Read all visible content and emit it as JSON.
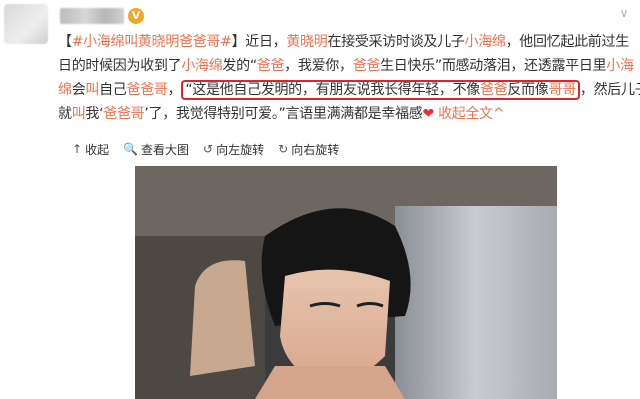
{
  "post": {
    "line1": [
      {
        "t": "【",
        "h": false
      },
      {
        "t": "#小海绵叫黄晓明爸爸哥#",
        "h": true
      },
      {
        "t": "】近日，",
        "h": false
      },
      {
        "t": "黄晓明",
        "h": true
      },
      {
        "t": "在接受采访时谈及儿子",
        "h": false
      },
      {
        "t": "小海绵",
        "h": true
      },
      {
        "t": "，他回忆起此前过生",
        "h": false
      }
    ],
    "line2": [
      {
        "t": "日的时候因为收到了",
        "h": false
      },
      {
        "t": "小海绵",
        "h": true
      },
      {
        "t": "发的“",
        "h": false
      },
      {
        "t": "爸爸",
        "h": true
      },
      {
        "t": "，我爱你，",
        "h": false
      },
      {
        "t": "爸爸",
        "h": true
      },
      {
        "t": "生日快乐”而感动落泪，还透露平日里",
        "h": false
      },
      {
        "t": "小海",
        "h": true
      }
    ],
    "line3_pre": [
      {
        "t": "绵",
        "h": true
      },
      {
        "t": "会",
        "h": false
      },
      {
        "t": "叫",
        "h": true
      },
      {
        "t": "自己",
        "h": false
      },
      {
        "t": "爸爸哥",
        "h": true
      },
      {
        "t": "，",
        "h": false
      }
    ],
    "line3_box": [
      {
        "t": "“这是他自己发明的，有朋友说我长得年轻，不像",
        "h": false
      },
      {
        "t": "爸爸",
        "h": true
      },
      {
        "t": "反而像",
        "h": false
      },
      {
        "t": "哥哥",
        "h": true
      }
    ],
    "line3_post": [
      {
        "t": "，然后儿子",
        "h": false
      }
    ],
    "line4": [
      {
        "t": "就",
        "h": false
      },
      {
        "t": "叫",
        "h": true
      },
      {
        "t": "我‘",
        "h": false
      },
      {
        "t": "爸爸哥",
        "h": true
      },
      {
        "t": "’了，我觉得特别可爱。”言语里满满都是幸福感",
        "h": false
      }
    ],
    "heart": "❤",
    "collapse": "收起全文",
    "collapse_arrow": "^",
    "dropdown_arrow": "∨",
    "verified": "V"
  },
  "toolbar": {
    "items": [
      {
        "icon": "↑",
        "label": "收起",
        "name": "collapse-button"
      },
      {
        "icon": "🔍",
        "label": "查看大图",
        "name": "view-large-button"
      },
      {
        "icon": "↺",
        "label": "向左旋转",
        "name": "rotate-left-button"
      },
      {
        "icon": "↻",
        "label": "向右旋转",
        "name": "rotate-right-button"
      }
    ]
  }
}
